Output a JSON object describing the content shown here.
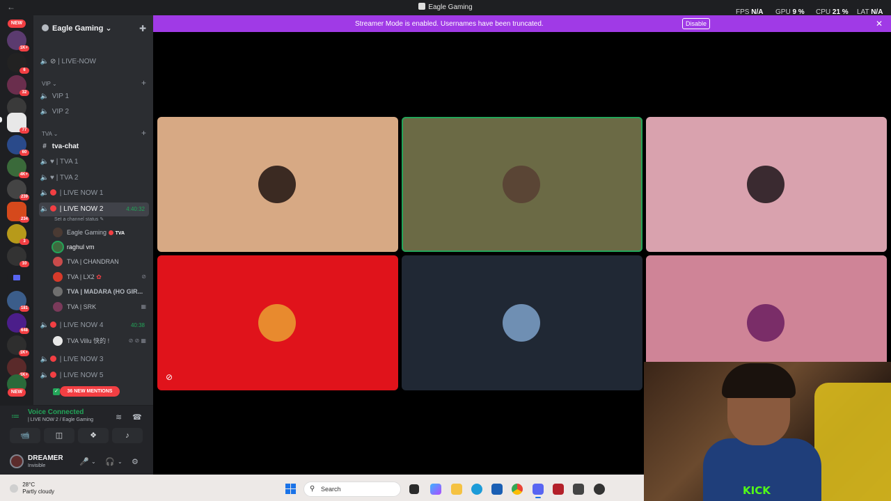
{
  "titlebar": {
    "title": "Eagle Gaming"
  },
  "perf": {
    "fps_label": "FPS",
    "fps_value": "N/A",
    "gpu_label": "GPU",
    "gpu_value": "9 %",
    "cpu_label": "CPU",
    "cpu_value": "21 %",
    "lat_label": "LAT",
    "lat_value": "N/A"
  },
  "servers": {
    "top_badge": "NEW",
    "bottom_badge": "NEW",
    "badges": [
      "1K+",
      "6",
      "32",
      "77",
      "60",
      "4K+",
      "239",
      "234",
      "3",
      "10",
      "181",
      "648",
      "1K+",
      "1K+"
    ]
  },
  "guild": {
    "name": "Eagle Gaming"
  },
  "channels": {
    "live_now": "| LIVE-NOW",
    "vip_category": "VIP",
    "vip1": "VIP 1",
    "vip2": "VIP 2",
    "tva_category": "TVA",
    "tva_chat": "tva-chat",
    "tva1": "| TVA 1",
    "tva2": "| TVA 2",
    "live1": "| LIVE NOW 1",
    "live2": "| LIVE NOW 2",
    "live2_timer": "4:40:32",
    "set_status": "Set a channel status",
    "live4": "| LIVE NOW 4",
    "live4_timer": "40:38",
    "live3": "| LIVE NOW 3",
    "live5": "| LIVE NOW 5",
    "mentions": "36 NEW MENTIONS"
  },
  "voice_users": [
    {
      "name": "Eagle Gaming",
      "tag": "TVA"
    },
    {
      "name": "raghul vm"
    },
    {
      "name": "TVA | CHANDRAN"
    },
    {
      "name": "TVA | LX2"
    },
    {
      "name": "TVA | MADARA (HO GIR..."
    },
    {
      "name": "TVA | SRK"
    }
  ],
  "live4_users": [
    {
      "name": "TVA Villu 快的 !"
    }
  ],
  "voice_panel": {
    "status": "Voice Connected",
    "channel": "| LIVE NOW 2 / Eagle Gaming"
  },
  "user": {
    "name": "DREAMER",
    "status": "Invisible"
  },
  "banner": {
    "message": "Streamer Mode is enabled. Usernames have been truncated.",
    "disable_label": "Disable"
  },
  "tiles": [
    {
      "bg": "#d7a984",
      "avatar": "#3b2a22",
      "speaking": false,
      "muted": false
    },
    {
      "bg": "#6b6a45",
      "avatar": "#5a4535",
      "speaking": true,
      "muted": false
    },
    {
      "bg": "#d9a2ae",
      "avatar": "#3a2a30",
      "speaking": false,
      "muted": false
    },
    {
      "bg": "#e0131b",
      "avatar": "#e88a2e",
      "speaking": false,
      "muted": true
    },
    {
      "bg": "#202834",
      "avatar": "#6f8fb3",
      "speaking": false,
      "muted": false
    },
    {
      "bg": "#cf8497",
      "avatar": "#7a2d68",
      "speaking": false,
      "muted": false
    }
  ],
  "webcam": {
    "overlay_text": "KICK"
  },
  "taskbar": {
    "temperature": "28°C",
    "weather": "Partly cloudy",
    "search_placeholder": "Search"
  }
}
